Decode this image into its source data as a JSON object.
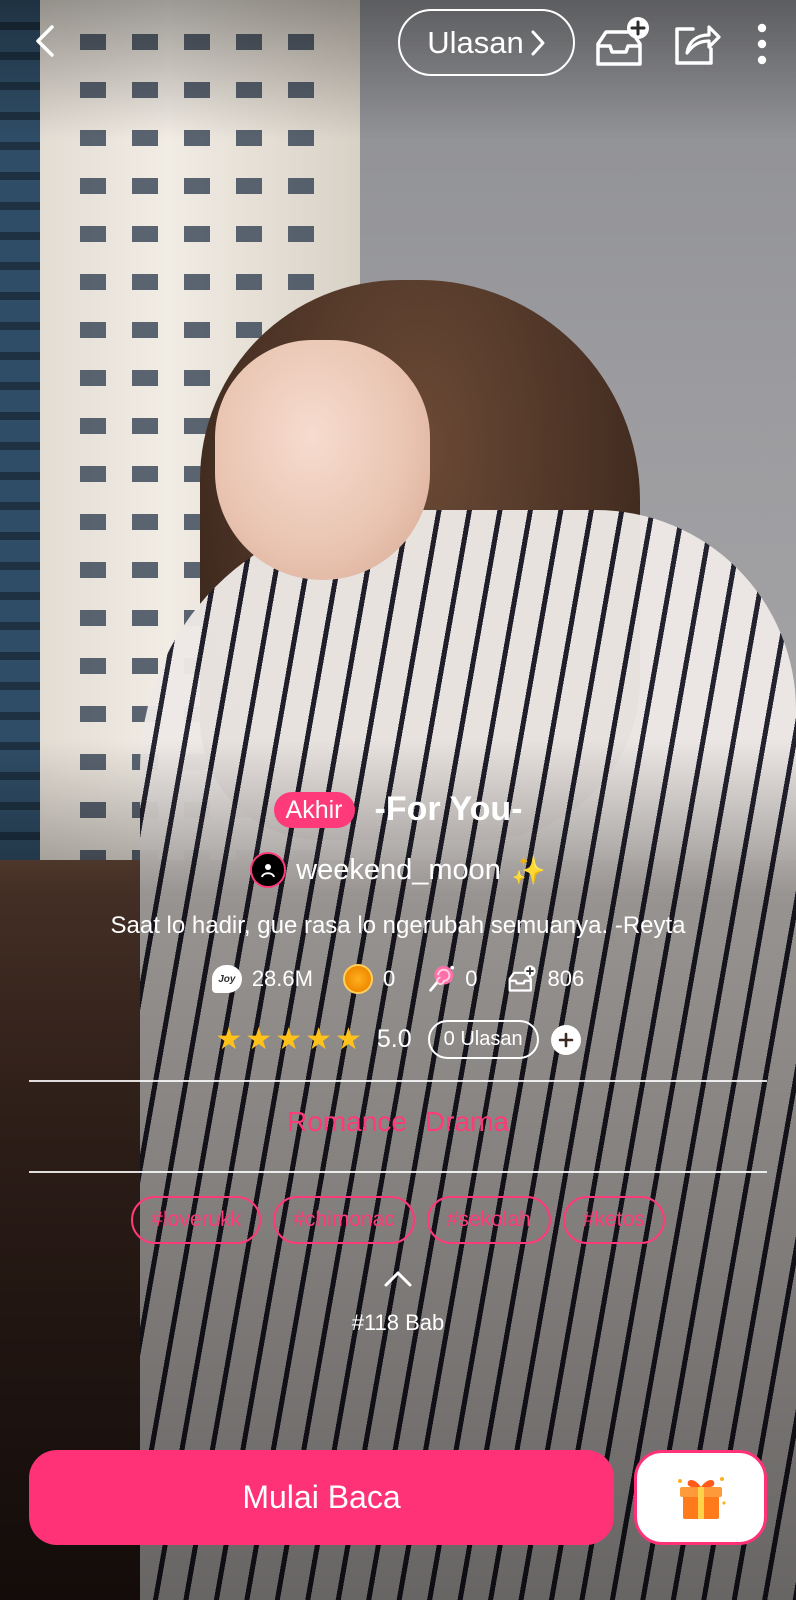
{
  "header": {
    "reviews_label": "Ulasan"
  },
  "book": {
    "status": "Akhir",
    "title": "-For You-",
    "author": "weekend_moon",
    "author_emoji": "✨",
    "synopsis": "Saat lo hadir, gue rasa lo ngerubah semuanya. -Reyta"
  },
  "stats": {
    "reads": "28.6M",
    "coins": "0",
    "lollipops": "0",
    "library_adds": "806",
    "joy_icon_text": "Joy"
  },
  "rating": {
    "value": "5.0",
    "stars": 5,
    "reviews_label": "0 Ulasan"
  },
  "genres": [
    "Romance",
    "Drama"
  ],
  "tags": [
    "#loverukk",
    "#chimonac",
    "#sekolah",
    "#ketos"
  ],
  "chapters": "#118 Bab",
  "actions": {
    "start_label": "Mulai Baca"
  },
  "colors": {
    "accent": "#ff3278",
    "star": "#ffc21a"
  },
  "icons": [
    "back-arrow-icon",
    "chevron-right-icon",
    "add-to-shelf-icon",
    "share-icon",
    "more-vertical-icon",
    "joy-reads-icon",
    "coin-icon",
    "lollipop-icon",
    "shelf-plus-icon",
    "star-icon",
    "plus-icon",
    "chevron-up-icon",
    "gift-box-icon"
  ]
}
